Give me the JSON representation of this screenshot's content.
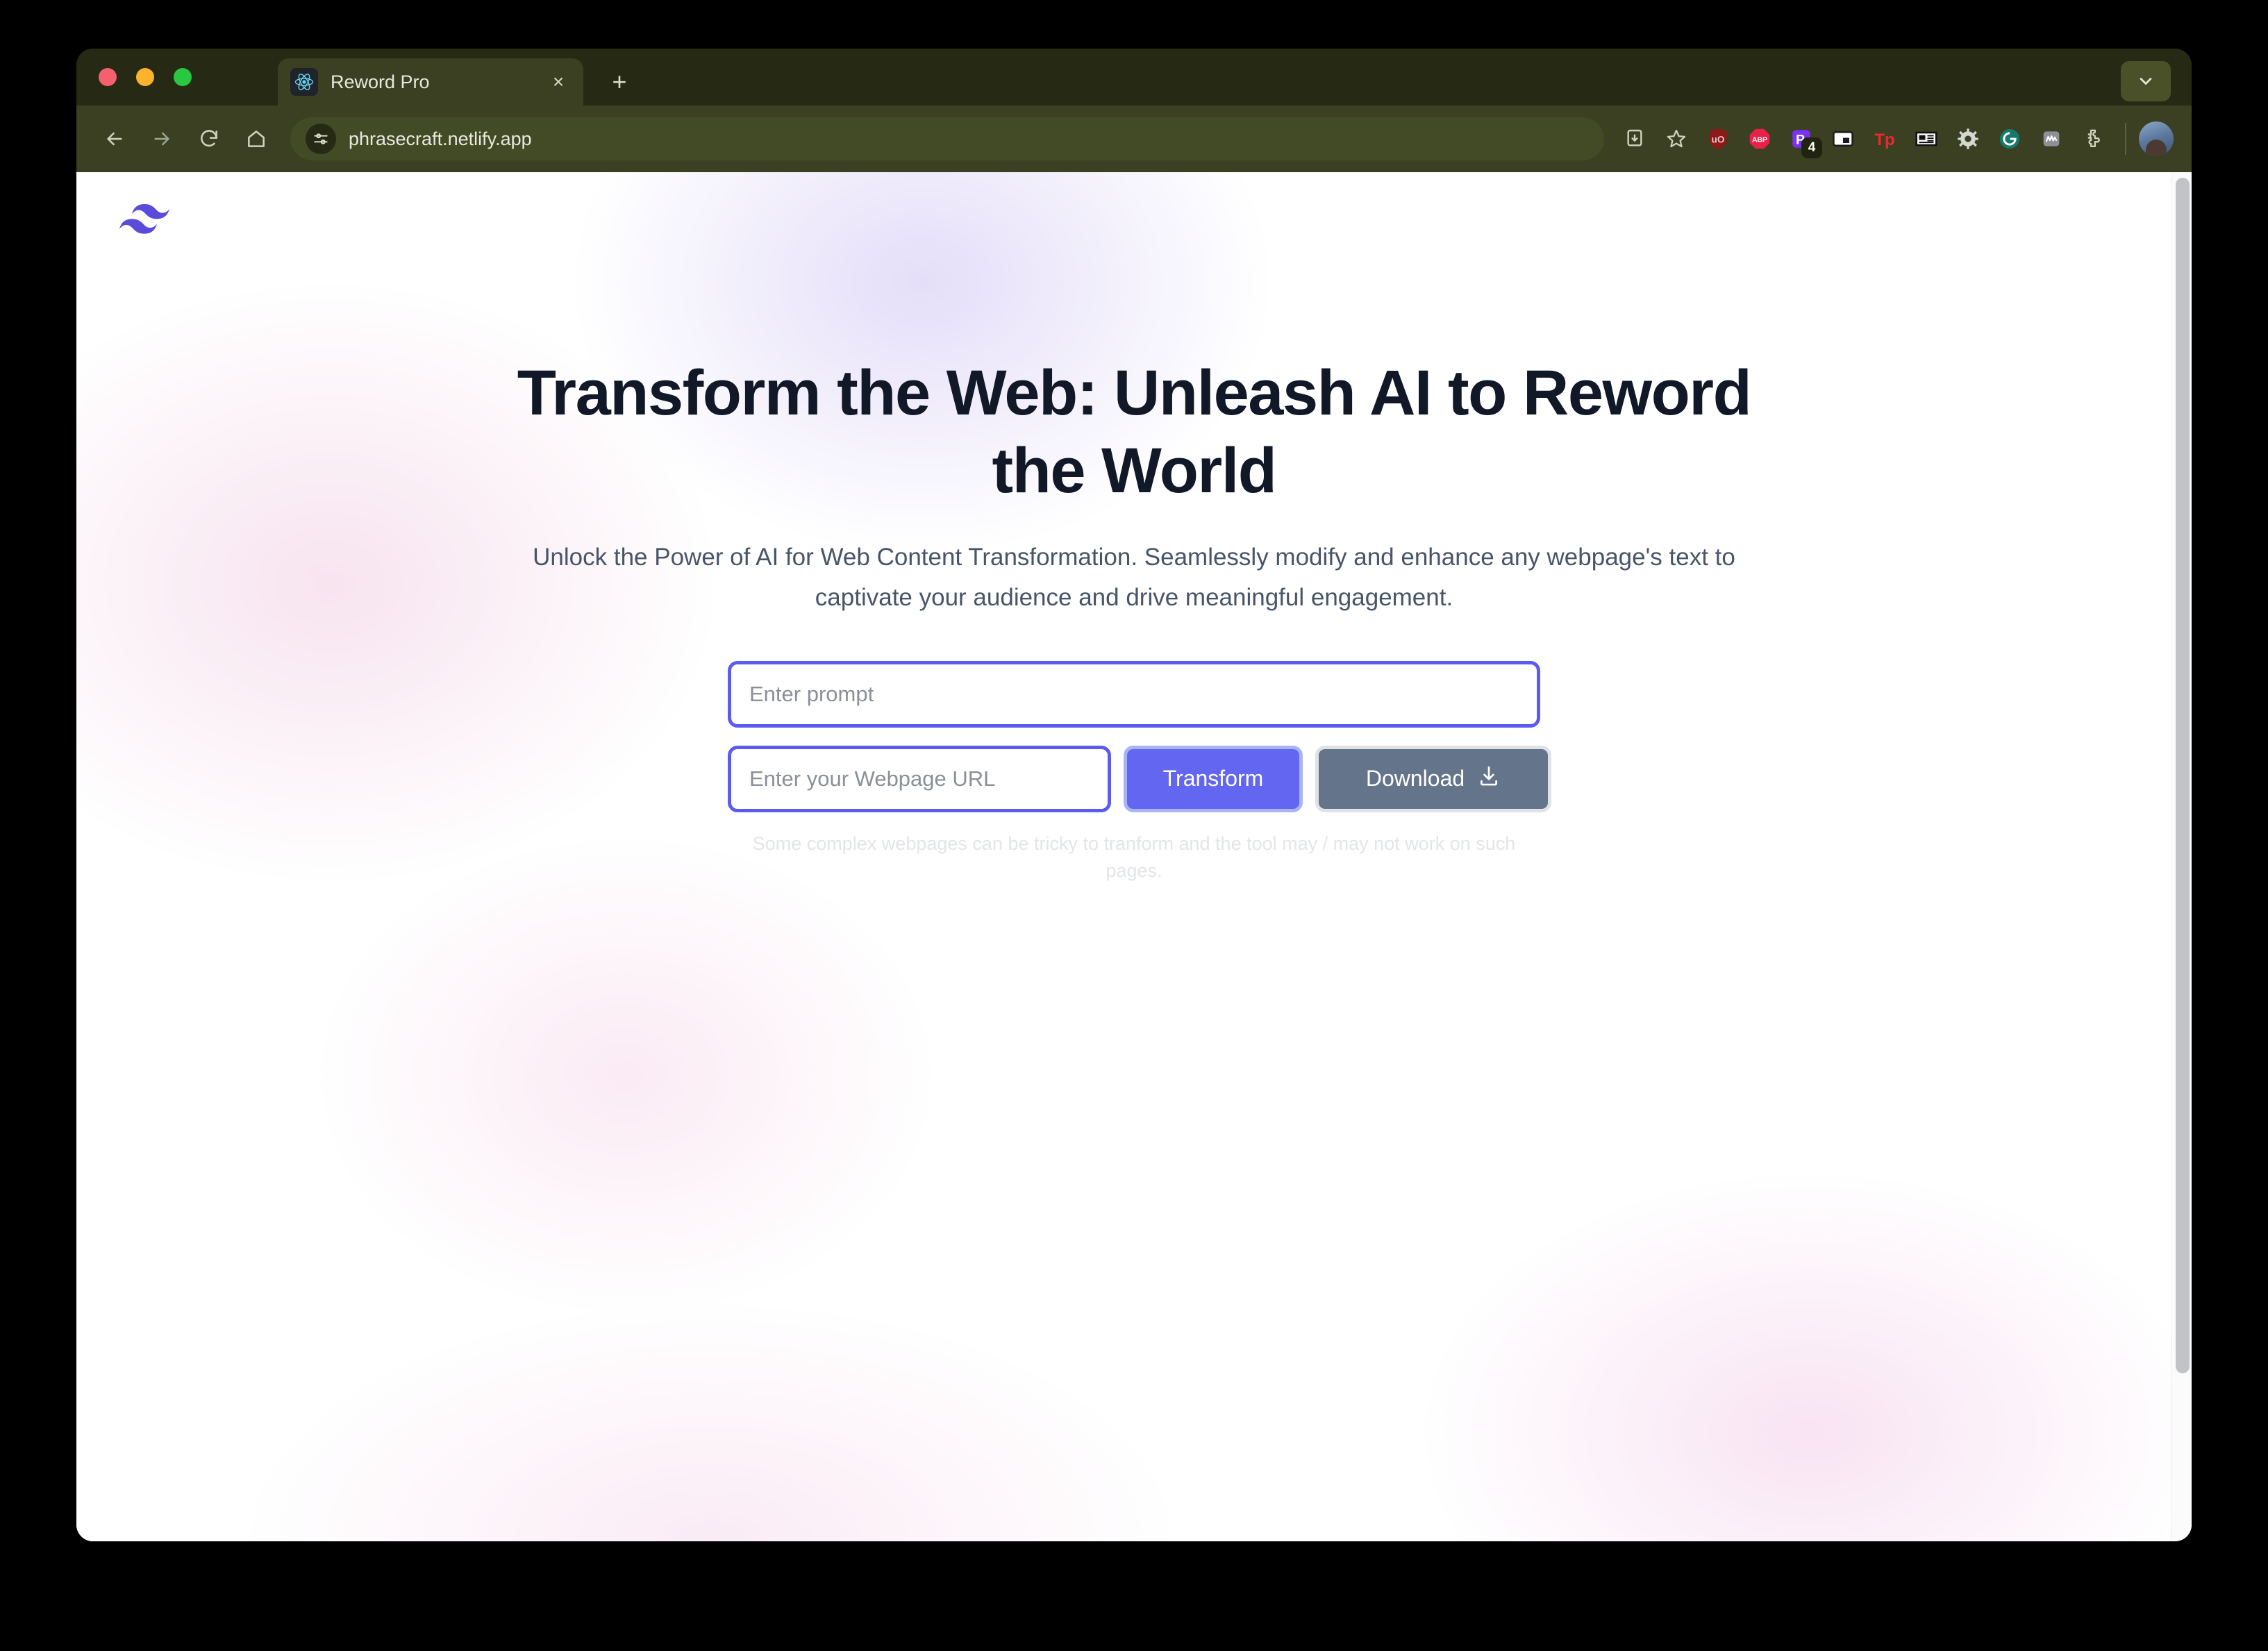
{
  "browser": {
    "traffic_lights": [
      "close",
      "minimize",
      "zoom"
    ],
    "tab": {
      "title": "Reword Pro",
      "favicon": "react-icon",
      "close_label": "×"
    },
    "new_tab_label": "+",
    "tab_search": "chevron-down-icon",
    "toolbar": {
      "back": "back-arrow-icon",
      "forward": "forward-arrow-icon",
      "reload": "reload-icon",
      "home": "home-icon",
      "site_settings": "site-settings-icon",
      "url": "phrasecraft.netlify.app",
      "install_app": "install-app-icon",
      "bookmark": "bookmark-star-icon",
      "extensions": [
        {
          "name": "ublock-origin-icon",
          "label": "uO",
          "badge": null
        },
        {
          "name": "adblock-plus-icon",
          "label": "ABP",
          "badge": null
        },
        {
          "name": "pocket-extension-icon",
          "label": "P",
          "badge": "4"
        },
        {
          "name": "reader-view-icon",
          "label": "",
          "badge": null
        },
        {
          "name": "tp-extension-icon",
          "label": "Tp",
          "badge": null
        },
        {
          "name": "newspaper-extension-icon",
          "label": "",
          "badge": null
        },
        {
          "name": "gear-extension-icon",
          "label": "",
          "badge": null
        },
        {
          "name": "grammarly-icon",
          "label": "G",
          "badge": null
        },
        {
          "name": "mv-extension-icon",
          "label": "MͰ",
          "badge": null
        },
        {
          "name": "puzzle-extensions-icon",
          "label": "",
          "badge": null
        }
      ],
      "profile": "avatar"
    }
  },
  "page": {
    "logo": "tailwind-wave-logo",
    "hero": {
      "title": "Transform the Web: Unleash AI to Reword the World",
      "subtitle": "Unlock the Power of AI for Web Content Transformation. Seamlessly modify and enhance any webpage's text to captivate your audience and drive meaningful engagement."
    },
    "form": {
      "prompt_placeholder": "Enter prompt",
      "prompt_value": "",
      "url_placeholder": "Enter your Webpage URL",
      "url_value": "",
      "transform_label": "Transform",
      "download_label": "Download",
      "download_icon": "download-icon"
    },
    "disclaimer": "Some complex webpages can be tricky to tranform and the tool may / may not work on such pages."
  },
  "colors": {
    "chrome_tabstrip": "#262a14",
    "chrome_toolbar": "#3a4021",
    "accent_indigo": "#6366f1",
    "field_border": "#5b5bef",
    "download_slate": "#64748b",
    "heading": "#111827",
    "subtitle": "#475569",
    "disclaimer": "#e3e5e9"
  }
}
